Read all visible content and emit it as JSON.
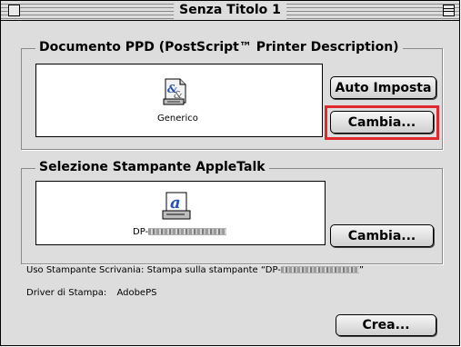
{
  "window": {
    "title": "Senza Titolo 1"
  },
  "ppd_section": {
    "title": "Documento PPD (PostScript™ Printer Description)",
    "icon": "ppd-file-icon",
    "file_label": "Generico",
    "auto_button": "Auto Imposta",
    "change_button": "Cambia..."
  },
  "printer_section": {
    "title": "Selezione Stampante AppleTalk",
    "icon": "laserwriter-printer-icon",
    "printer_label": "DP-",
    "change_button": "Cambia..."
  },
  "info": {
    "usage_text": "Uso Stampante Scrivania: Stampa sulla stampante “DP-",
    "usage_suffix": "”",
    "driver_label": "Driver di Stampa:",
    "driver_value": "AdobePS"
  },
  "create_button": "Crea...",
  "colors": {
    "window_bg": "#dddddd",
    "highlight": "#e0282e"
  }
}
